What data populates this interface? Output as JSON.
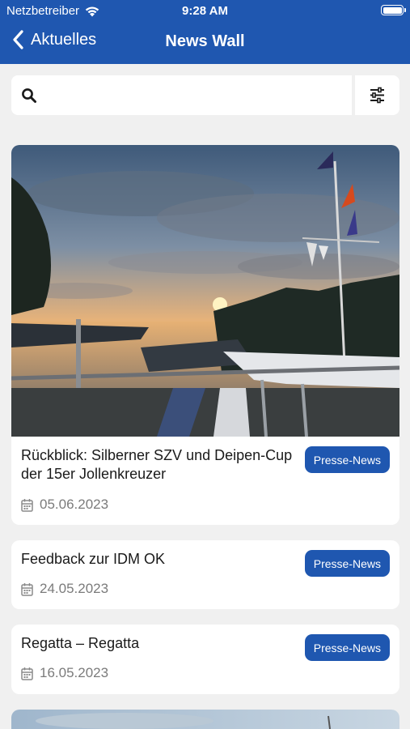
{
  "status_bar": {
    "carrier": "Netzbetreiber",
    "time": "9:28 AM"
  },
  "nav": {
    "back_label": "Aktuelles",
    "title": "News Wall"
  },
  "search": {
    "placeholder": "",
    "value": ""
  },
  "icons": {
    "back": "chevron-left-icon",
    "search": "search-icon",
    "filter": "sliders-icon",
    "date": "calendar-icon"
  },
  "colors": {
    "primary": "#1f57b0",
    "background": "#f0f0f0",
    "card": "#ffffff",
    "muted_text": "#7b7b7b"
  },
  "news": [
    {
      "title": "Rückblick: Silberner SZV und Deipen-Cup der 15er Jollenkreuzer",
      "tag": "Presse-News",
      "date": "05.06.2023",
      "image": "sunset over marina with flagpole and sailboats"
    },
    {
      "title": "Feedback zur IDM OK",
      "tag": "Presse-News",
      "date": "24.05.2023"
    },
    {
      "title": "Regatta – Regatta",
      "tag": "Presse-News",
      "date": "16.05.2023"
    }
  ]
}
